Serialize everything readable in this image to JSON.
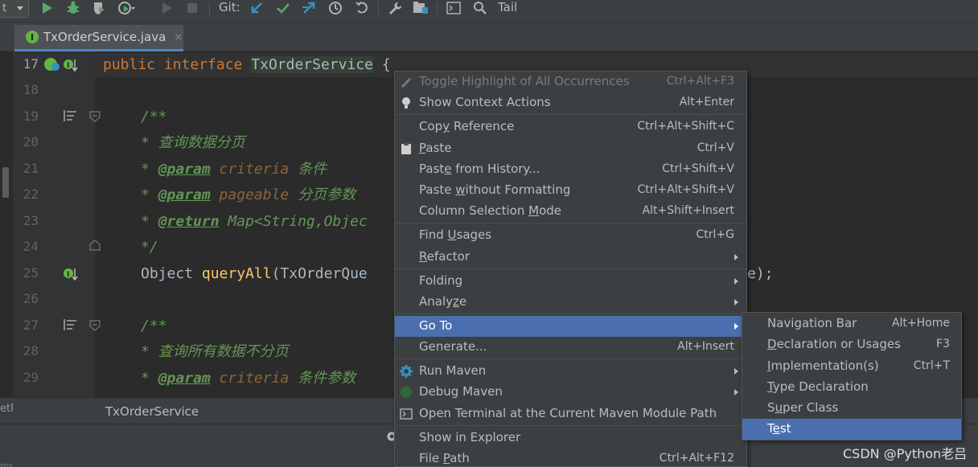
{
  "toolbar": {
    "run_config_label": "t",
    "git_label": "Git:",
    "tail_label": "Tail"
  },
  "tab": {
    "badge": "I",
    "file_name": "TxOrderService.java",
    "close": "×"
  },
  "editor": {
    "line_numbers": [
      "17",
      "18",
      "19",
      "20",
      "21",
      "22",
      "23",
      "24",
      "25",
      "26",
      "27",
      "28",
      "29"
    ],
    "lines": {
      "l17_kw1": "public",
      "l17_kw2": "interface",
      "l17_cls": "TxOrderService",
      "l17_brace": "{",
      "l19": "/**",
      "l20": "* 查询数据分页",
      "l21_star": "* ",
      "l21_tag": "@param",
      "l21_name": " criteria",
      "l21_desc": " 条件",
      "l22_star": "* ",
      "l22_tag": "@param",
      "l22_name": " pageable",
      "l22_desc": " 分页参数",
      "l23_star": "* ",
      "l23_tag": "@return",
      "l23_rest": " Map<String,Objec",
      "l24": "*/",
      "l25_type": "Object ",
      "l25_method": "queryAll",
      "l25_args": "(TxOrderQue",
      "l25_tail": "e);",
      "l27": "/**",
      "l28": "* 查询所有数据不分页",
      "l29_star": "* ",
      "l29_tag": "@param",
      "l29_name": " criteria",
      "l29_desc": " 条件参数"
    }
  },
  "breadcrumb": {
    "item": "TxOrderService",
    "left_stub": "etR",
    "bottom_stub": "ms"
  },
  "context_menu": {
    "items": [
      {
        "label": "Toggle Highlight of All Occurrences",
        "shortcut": "Ctrl+Alt+F3"
      },
      {
        "label": "Show Context Actions",
        "shortcut": "Alt+Enter"
      },
      {
        "label_pre": "Cop",
        "label_u": "y",
        "label_post": " Reference",
        "shortcut": "Ctrl+Alt+Shift+C"
      },
      {
        "label_pre": "",
        "label_u": "P",
        "label_post": "aste",
        "shortcut": "Ctrl+V"
      },
      {
        "label_pre": "Past",
        "label_u": "e",
        "label_post": " from History...",
        "shortcut": "Ctrl+Shift+V"
      },
      {
        "label_pre": "Paste ",
        "label_u": "w",
        "label_post": "ithout Formatting",
        "shortcut": "Ctrl+Alt+Shift+V"
      },
      {
        "label_pre": "Column Selection ",
        "label_u": "M",
        "label_post": "ode",
        "shortcut": "Alt+Shift+Insert"
      },
      {
        "label_pre": "Find ",
        "label_u": "U",
        "label_post": "sages",
        "shortcut": "Ctrl+G"
      },
      {
        "label_pre": "",
        "label_u": "R",
        "label_post": "efactor",
        "shortcut": ""
      },
      {
        "label": "Folding",
        "shortcut": ""
      },
      {
        "label_pre": "Analy",
        "label_u": "z",
        "label_post": "e",
        "shortcut": ""
      },
      {
        "label": "Go To",
        "shortcut": ""
      },
      {
        "label": "Generate...",
        "shortcut": "Alt+Insert"
      },
      {
        "label": "Run Maven",
        "shortcut": ""
      },
      {
        "label": "Debug Maven",
        "shortcut": ""
      },
      {
        "label": "Open Terminal at the Current Maven Module Path",
        "shortcut": ""
      },
      {
        "label": "Show in Explorer",
        "shortcut": ""
      },
      {
        "label_pre": "File ",
        "label_u": "P",
        "label_post": "ath",
        "shortcut": "Ctrl+Alt+F12"
      }
    ]
  },
  "submenu": {
    "items": [
      {
        "label": "Navigation Bar",
        "shortcut": "Alt+Home"
      },
      {
        "label_pre": "",
        "label_u": "D",
        "label_post": "eclaration or Usages",
        "shortcut": "F3"
      },
      {
        "label_pre": "",
        "label_u": "I",
        "label_post": "mplementation(s)",
        "shortcut": "Ctrl+T"
      },
      {
        "label_pre": "",
        "label_u": "T",
        "label_post": "ype Declaration",
        "shortcut": ""
      },
      {
        "label_pre": "S",
        "label_u": "u",
        "label_post": "per Class",
        "shortcut": ""
      },
      {
        "label_pre": "T",
        "label_u": "e",
        "label_post": "st",
        "shortcut": ""
      }
    ]
  },
  "watermark": "CSDN @Python老吕",
  "colors": {
    "selection": "#4b6eaf",
    "keyword": "#cc7832",
    "comment": "#629755",
    "method": "#ffc66d"
  }
}
